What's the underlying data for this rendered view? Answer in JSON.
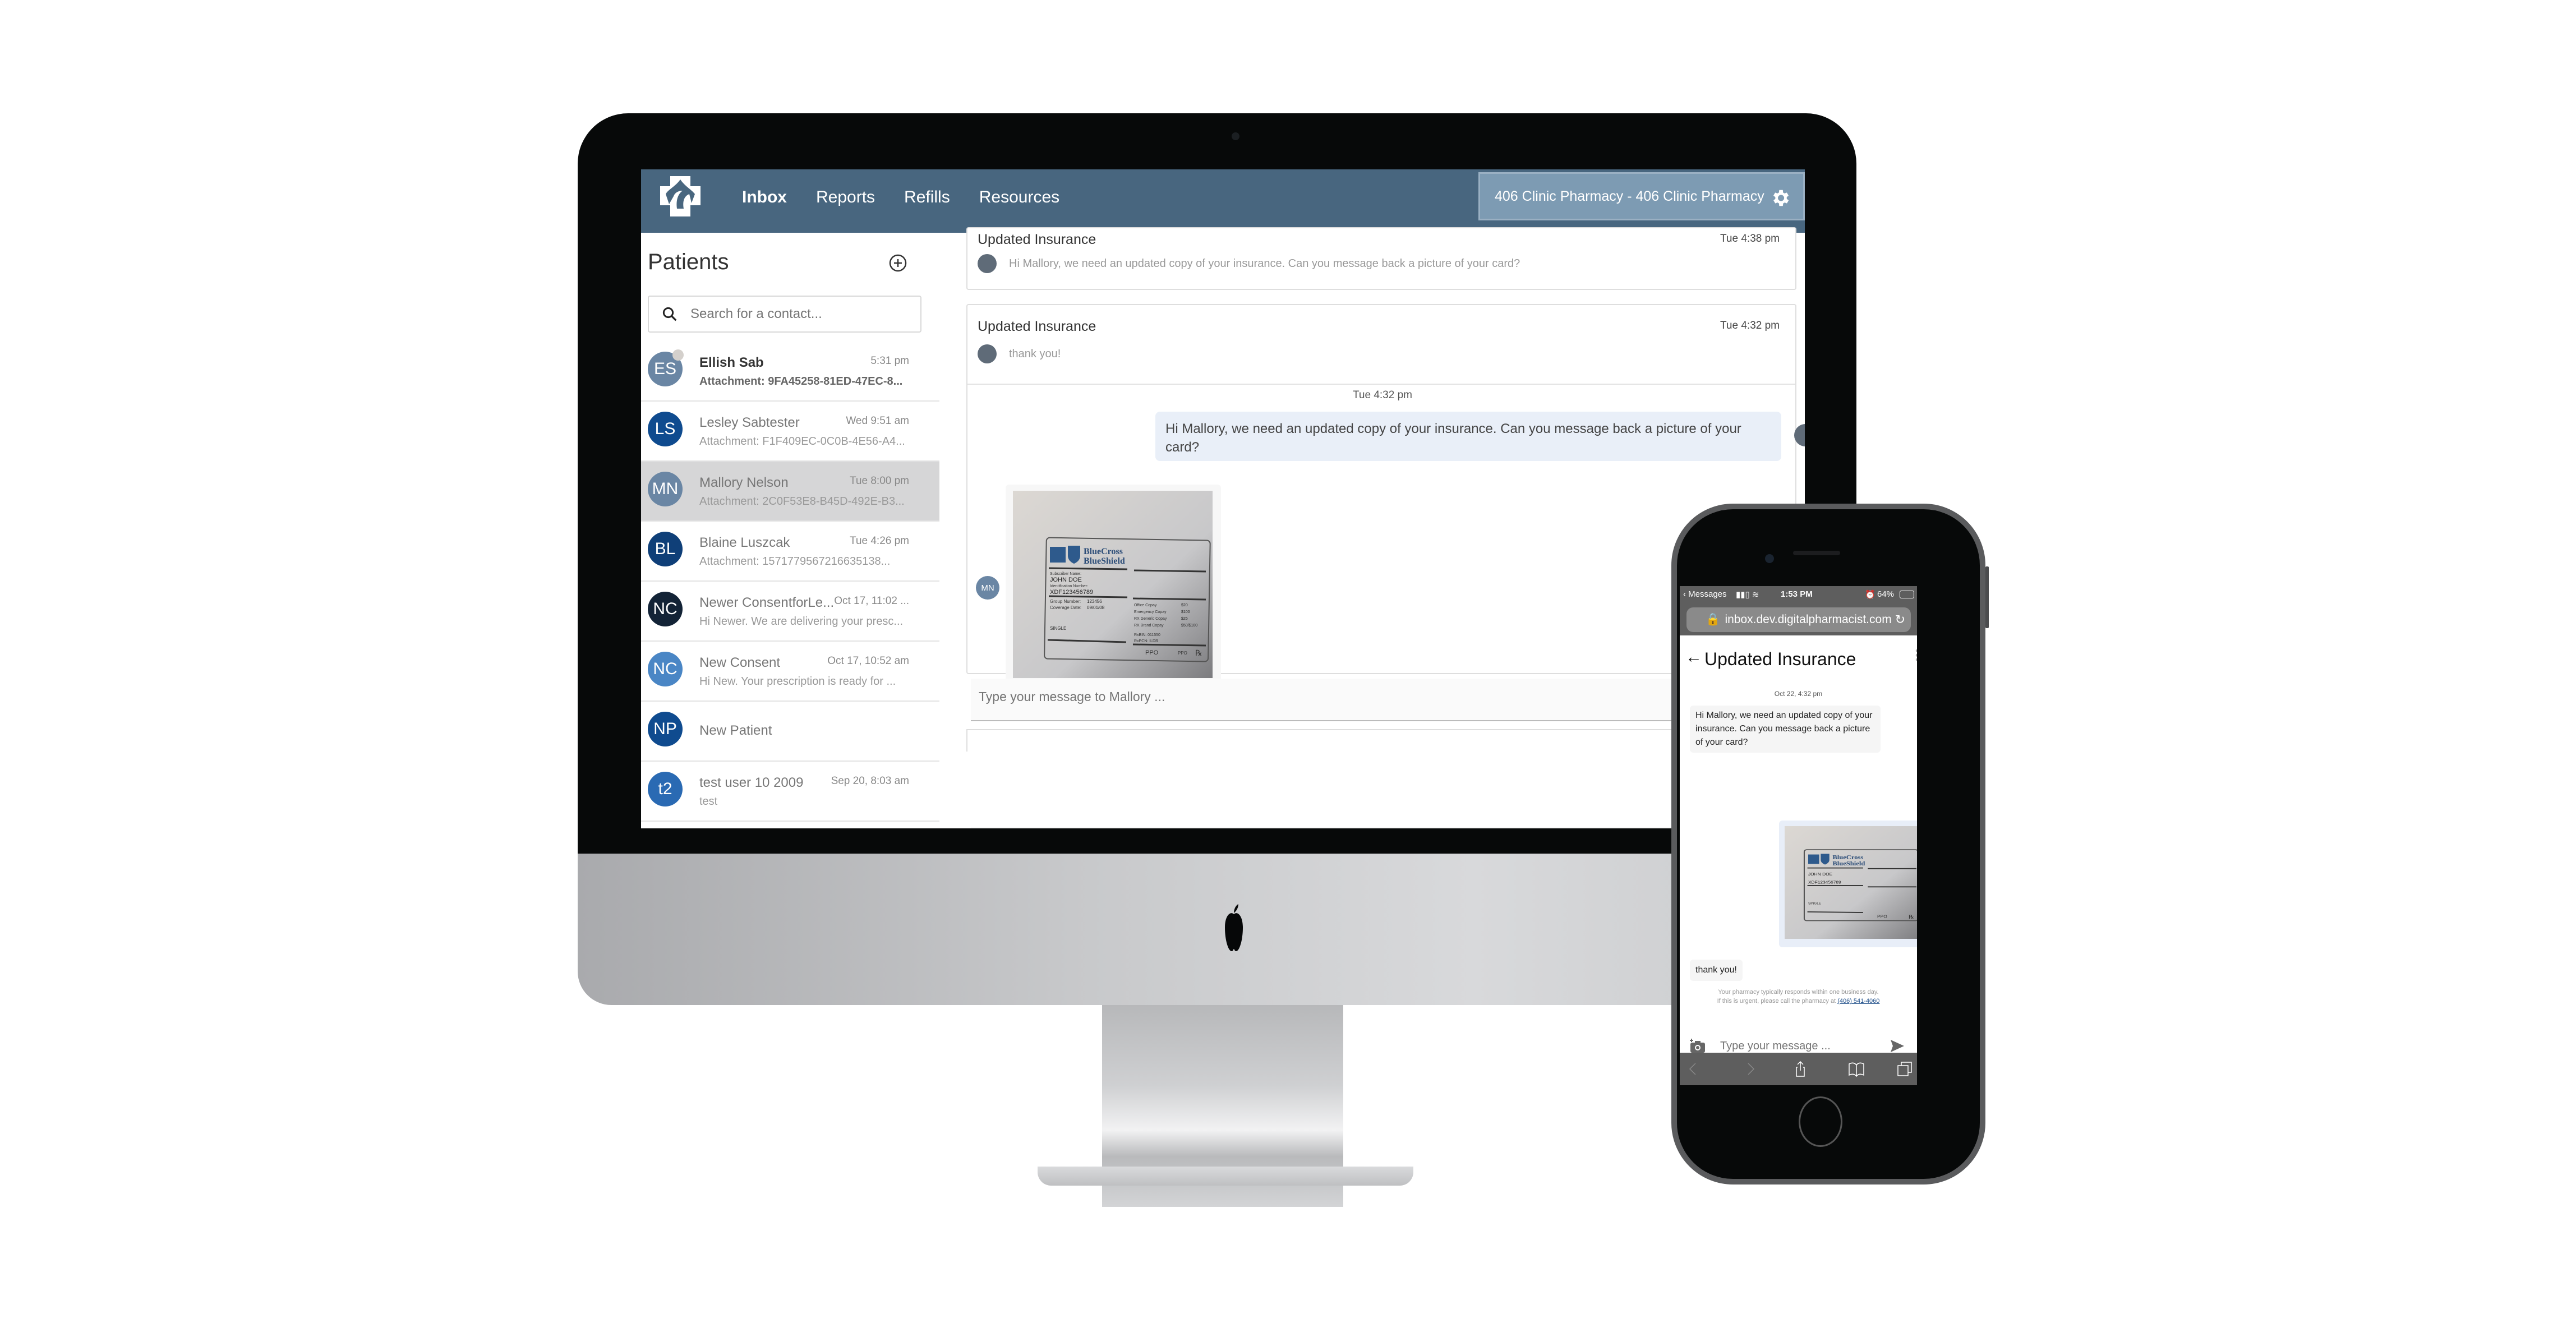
{
  "desktop": {
    "nav": {
      "items": [
        {
          "label": "Inbox",
          "active": true
        },
        {
          "label": "Reports",
          "active": false
        },
        {
          "label": "Refills",
          "active": false
        },
        {
          "label": "Resources",
          "active": false
        }
      ],
      "pharmacy_selector": "406 Clinic Pharmacy - 406 Clinic Pharmacy"
    },
    "patients": {
      "title": "Patients",
      "search_placeholder": "Search for a contact...",
      "list": [
        {
          "initials": "ES",
          "name": "Ellish Sab",
          "time": "5:31 pm",
          "preview": "Attachment: 9FA45258-81ED-47EC-8...",
          "avatar_color": "#6a86a4",
          "unread": true,
          "selected": false
        },
        {
          "initials": "LS",
          "name": "Lesley Sabtester",
          "time": "Wed 9:51 am",
          "preview": "Attachment: F1F409EC-0C0B-4E56-A4...",
          "avatar_color": "#0f4b8f",
          "unread": false,
          "selected": false
        },
        {
          "initials": "MN",
          "name": "Mallory Nelson",
          "time": "Tue 8:00 pm",
          "preview": "Attachment: 2C0F53E8-B45D-492E-B3...",
          "avatar_color": "#6a86a4",
          "unread": false,
          "selected": true
        },
        {
          "initials": "BL",
          "name": "Blaine Luszcak",
          "time": "Tue 4:26 pm",
          "preview": "Attachment: 1571779567216635138...",
          "avatar_color": "#0f3f78",
          "unread": false,
          "selected": false
        },
        {
          "initials": "NC",
          "name": "Newer ConsentforLe...",
          "time": "Oct 17, 11:02 ...",
          "preview": "Hi Newer. We are delivering your presc...",
          "avatar_color": "#132336",
          "unread": false,
          "selected": false
        },
        {
          "initials": "NC",
          "name": "New Consent",
          "time": "Oct 17, 10:52 am",
          "preview": "Hi New. Your prescription is ready for ...",
          "avatar_color": "#4a86c5",
          "unread": false,
          "selected": false
        },
        {
          "initials": "NP",
          "name": "New Patient",
          "time": "",
          "preview": "",
          "avatar_color": "#0f4b8f",
          "unread": false,
          "selected": false
        },
        {
          "initials": "t2",
          "name": "test user 10 2009",
          "time": "Sep 20, 8:03 am",
          "preview": "test",
          "avatar_color": "#2a6ab3",
          "unread": false,
          "selected": false
        }
      ]
    },
    "conversation": {
      "threads": [
        {
          "title": "Updated Insurance",
          "time": "Tue 4:38 pm",
          "message": "Hi Mallory, we need an updated copy of your insurance. Can you message back a picture of your card?"
        },
        {
          "title": "Updated Insurance",
          "time": "Tue 4:32 pm",
          "message": "thank you!"
        }
      ],
      "chat_date": "Tue 4:32 pm",
      "outgoing_message": "Hi Mallory, we need an updated copy of your insurance. Can you message back a picture of your card?",
      "incoming_sender_initials": "MN",
      "attachment": {
        "brand": [
          "BlueCross",
          "BlueShield"
        ],
        "subscriber_label": "Subscriber Name:",
        "subscriber": "JOHN DOE",
        "id_label": "Identification Number:",
        "id": "XDF123456789",
        "group_label": "Group Number:",
        "group": "123456",
        "coverage_label": "Coverage Date:",
        "coverage": "09/01/08",
        "plan": "SINGLE",
        "copays": [
          {
            "label": "Office Copay",
            "value": "$20"
          },
          {
            "label": "Emergency Copay",
            "value": "$100"
          },
          {
            "label": "RX Generic Copay",
            "value": "$25"
          },
          {
            "label": "RX Brand Copay",
            "value": "$50/$100"
          }
        ],
        "rxbin": "RxBIN: 011550",
        "rxpcn": "RxPCN: ILDR",
        "ppo": "PPO"
      },
      "composer_placeholder": "Type your message to Mallory ..."
    }
  },
  "phone": {
    "status": {
      "back_app": "Messages",
      "time": "1:53 PM",
      "battery": "64%"
    },
    "url": "inbox.dev.digitalpharmacist.com",
    "title": "Updated Insurance",
    "date": "Oct 22, 4:32 pm",
    "incoming_message": "Hi Mallory, we need an updated copy of your insurance. Can you message back a picture of your card?",
    "reply": "thank you!",
    "note_line1": "Your pharmacy typically responds within one business day.",
    "note_line2": "If this is urgent, please call the pharmacy at",
    "phone_number": "(406) 541-4060",
    "composer_placeholder": "Type your message ..."
  },
  "colors": {
    "topbar": "#48667f",
    "pharmacy_box": "#7d9bb3",
    "selected_row": "#d6d6d7",
    "outgoing_bubble": "#e9eff8",
    "link": "#1f4f8a"
  }
}
